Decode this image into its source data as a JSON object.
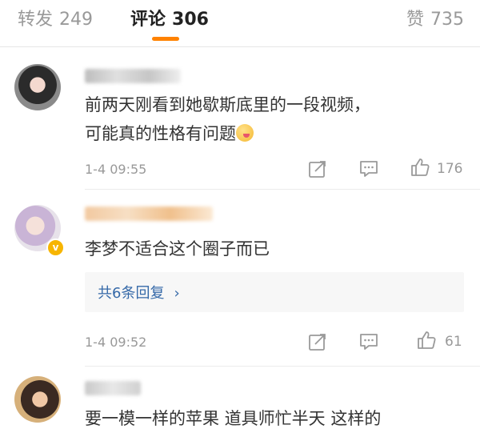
{
  "tabs": {
    "repost": {
      "label": "转发",
      "count": "249"
    },
    "comments": {
      "label": "评论",
      "count": "306"
    },
    "likes": {
      "label": "赞",
      "count": "735"
    }
  },
  "comments": [
    {
      "lines": [
        "前两天刚看到她歇斯底里的一段视频，",
        "可能真的性格有问题"
      ],
      "emoji": "drooling-face-emoji",
      "time": "1-4 09:55",
      "likes": "176"
    },
    {
      "lines": [
        "李梦不适合这个圈子而已"
      ],
      "verified_badge": "v",
      "replies_label": "共6条回复",
      "replies_chevron": "›",
      "time": "1-4 09:52",
      "likes": "61"
    },
    {
      "lines": [
        "要一模一样的苹果 道具师忙半天 这样的"
      ]
    }
  ],
  "icons": {
    "share": "share-edit-icon",
    "comment": "comment-bubble-icon",
    "like": "thumbs-up-icon"
  },
  "colors": {
    "accent": "#ff8200",
    "link": "#3569a8",
    "muted": "#999999",
    "text": "#333333"
  }
}
